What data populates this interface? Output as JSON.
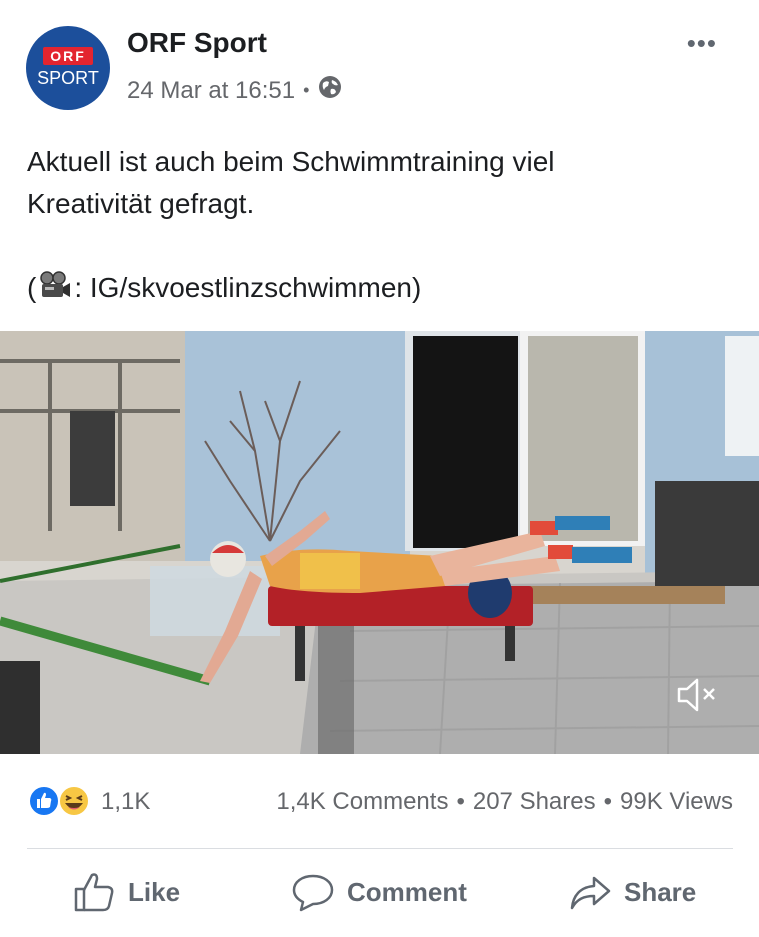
{
  "post": {
    "page_name": "ORF Sport",
    "avatar": {
      "top_text": "ORF",
      "bottom_text": "SPORT"
    },
    "timestamp": "24 Mar at 16:51",
    "audience_icon": "globe-icon",
    "more_label": "•••",
    "text_line1": "Aktuell ist auch beim Schwimmtraining viel",
    "text_line2": "Kreativität gefragt.",
    "credit_open": "(",
    "credit_text": ": IG/skvoestlinzschwimmen)"
  },
  "video": {
    "sound_icon": "muted-speaker-icon"
  },
  "stats": {
    "reactions_count": "1,1K",
    "comments": "1,4K Comments",
    "shares": "207 Shares",
    "views": "99K Views",
    "separator": "•"
  },
  "actions": {
    "like": "Like",
    "comment": "Comment",
    "share": "Share"
  },
  "colors": {
    "brand_blue": "#1c4f9b",
    "brand_red": "#e3252f",
    "like_blue": "#1877f2",
    "haha_yellow": "#f7c744",
    "muted_text": "#65676b"
  }
}
